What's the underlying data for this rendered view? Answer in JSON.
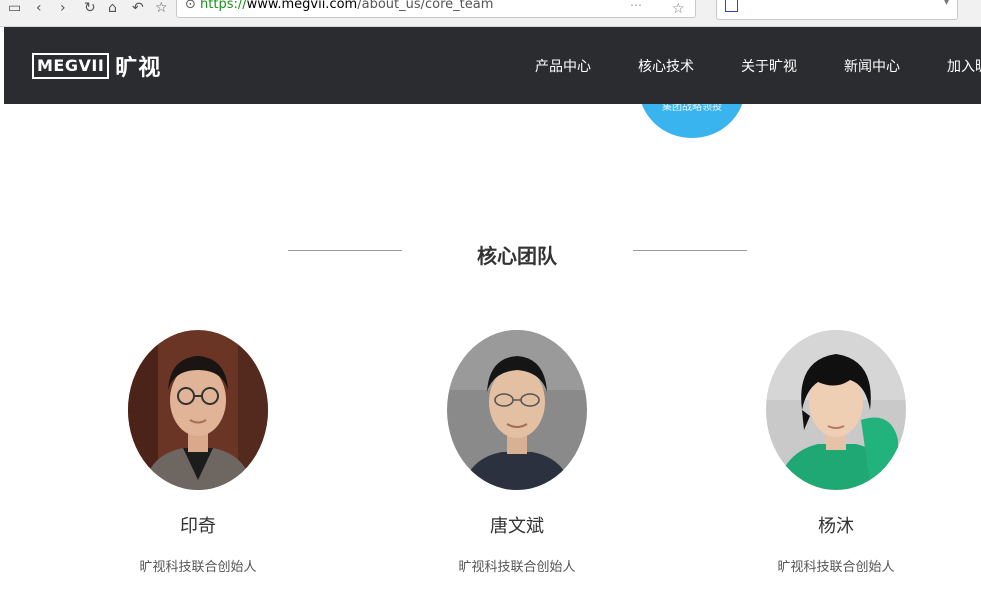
{
  "browser": {
    "url_scheme": "https://",
    "url_host": "www.megvii.com",
    "url_path": "/about_us/core_team"
  },
  "header": {
    "logo_latin": "MEGVII",
    "logo_cn": "旷视",
    "nav": [
      "产品中心",
      "核心技术",
      "关于旷视",
      "新闻中心",
      "加入旷视"
    ]
  },
  "circle_text": "集团战略领投",
  "section": {
    "title": "核心团队"
  },
  "team": [
    {
      "name": "印奇",
      "role": "旷视科技联合创始人"
    },
    {
      "name": "唐文斌",
      "role": "旷视科技联合创始人"
    },
    {
      "name": "杨沐",
      "role": "旷视科技联合创始人"
    }
  ],
  "colors": {
    "header_bg": "#2b2c30",
    "accent_blue": "#3ab4ee"
  }
}
